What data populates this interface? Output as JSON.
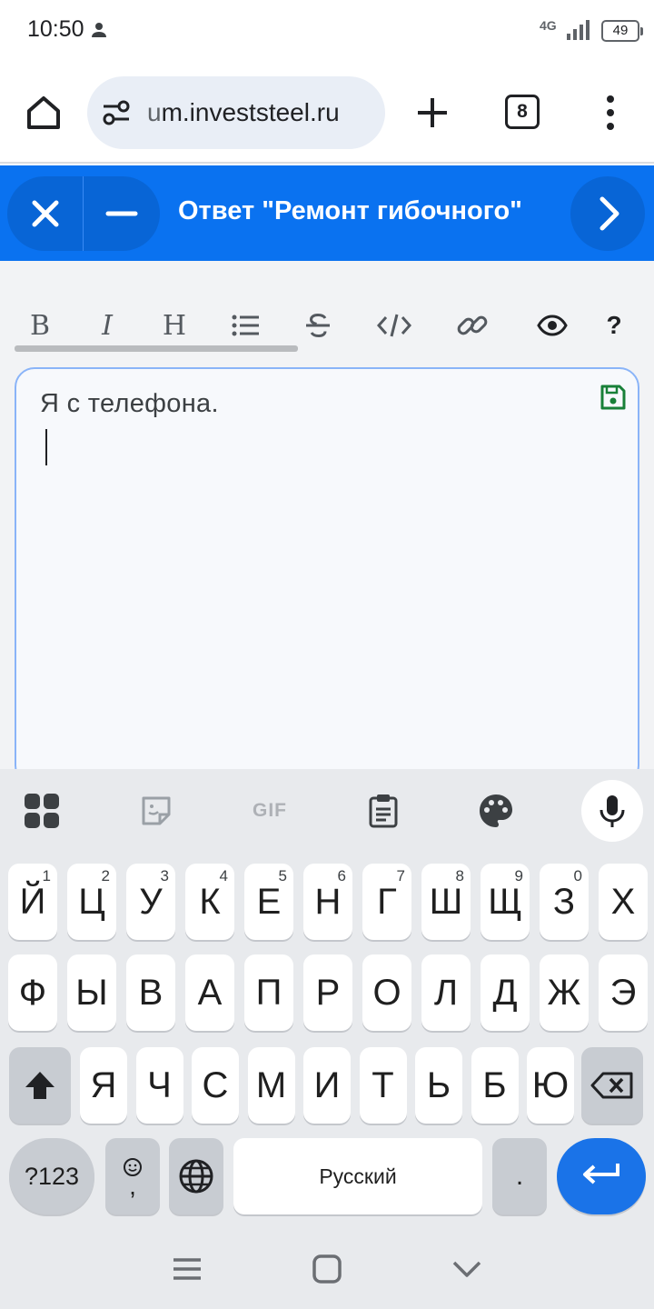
{
  "status": {
    "time": "10:50",
    "network": "4G",
    "battery": "49",
    "icons": [
      "person-icon",
      "signal-icon",
      "battery-icon"
    ]
  },
  "browser": {
    "url_dim": "u",
    "url_main": "m.investsteel.ru",
    "tab_count": "8",
    "icons": [
      "home-icon",
      "site-settings-icon",
      "plus-icon",
      "more-vert-icon"
    ]
  },
  "composer": {
    "title": "Ответ \"Ремонт гибочного\"",
    "icons": [
      "close-icon",
      "minimize-icon",
      "chevron-right-icon"
    ],
    "accent": "#0a72f0"
  },
  "toolbar": {
    "bold": "B",
    "italic": "I",
    "heading": "H",
    "help": "?",
    "icons": [
      "list-icon",
      "strikethrough-icon",
      "code-icon",
      "link-icon",
      "eye-icon",
      "save-icon"
    ]
  },
  "editor": {
    "text": "Я с телефона."
  },
  "keyboard": {
    "top_icons": [
      "apps-grid-icon",
      "sticker-icon",
      "gif-icon",
      "clipboard-icon",
      "palette-icon",
      "mic-icon"
    ],
    "gif_label": "GIF",
    "row1": [
      "Й",
      "Ц",
      "У",
      "К",
      "Е",
      "Н",
      "Г",
      "Ш",
      "Щ",
      "З",
      "Х"
    ],
    "row1_hints": [
      "1",
      "2",
      "3",
      "4",
      "5",
      "6",
      "7",
      "8",
      "9",
      "0"
    ],
    "row2": [
      "Ф",
      "Ы",
      "В",
      "А",
      "П",
      "Р",
      "О",
      "Л",
      "Д",
      "Ж",
      "Э"
    ],
    "row3": [
      "Я",
      "Ч",
      "С",
      "М",
      "И",
      "Т",
      "Ь",
      "Б",
      "Ю"
    ],
    "symbols_label": "?123",
    "comma_label": ",",
    "space_label": "Русский",
    "period_label": ".",
    "icons": [
      "shift-icon",
      "backspace-icon",
      "emoji-icon",
      "globe-icon",
      "enter-icon"
    ]
  },
  "navbar": {
    "icons": [
      "menu-icon",
      "home-square-icon",
      "back-chevron-icon"
    ]
  }
}
